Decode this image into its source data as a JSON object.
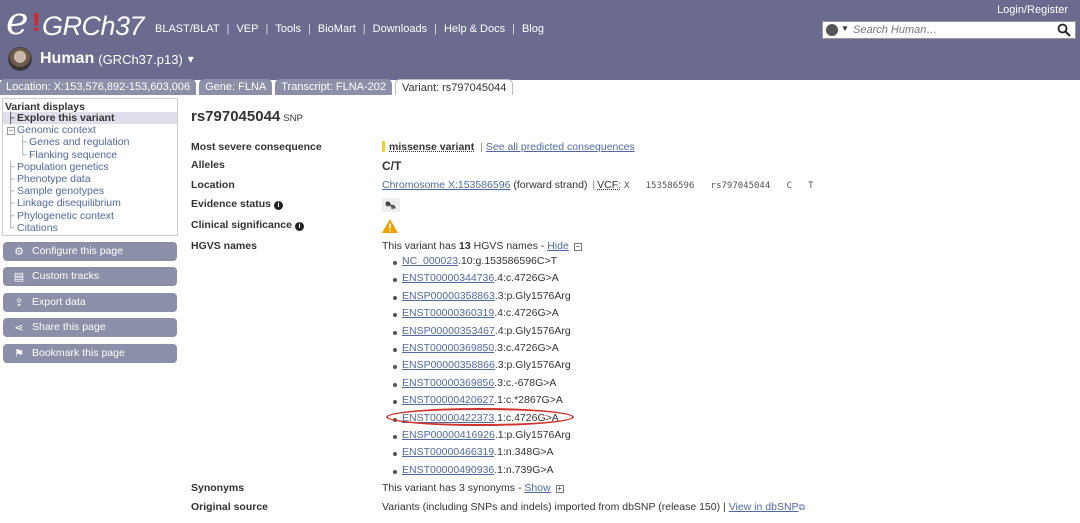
{
  "masthead": {
    "logo_e": "e",
    "logo_bang": "!",
    "logo_name": "GRCh37",
    "nav": [
      "BLAST/BLAT",
      "VEP",
      "Tools",
      "BioMart",
      "Downloads",
      "Help & Docs",
      "Blog"
    ],
    "login": "Login/Register",
    "search_placeholder": "Search Human…",
    "species_name": "Human",
    "species_assembly": "(GRCh37.p13)",
    "species_dropdown": "▾"
  },
  "tabs": [
    {
      "label": "Location: X:153,576,892-153,603,006"
    },
    {
      "label": "Gene: FLNA"
    },
    {
      "label": "Transcript: FLNA-202"
    },
    {
      "label": "Variant: rs797045044"
    }
  ],
  "sidebar": {
    "header": "Variant displays",
    "items": [
      {
        "label": "Explore this variant"
      },
      {
        "label": "Genomic context"
      },
      {
        "label": "Genes and regulation"
      },
      {
        "label": "Flanking sequence"
      },
      {
        "label": "Population genetics"
      },
      {
        "label": "Phenotype data"
      },
      {
        "label": "Sample genotypes"
      },
      {
        "label": "Linkage disequilibrium"
      },
      {
        "label": "Phylogenetic context"
      },
      {
        "label": "Citations"
      }
    ],
    "buttons": [
      {
        "label": "Configure this page"
      },
      {
        "label": "Custom tracks"
      },
      {
        "label": "Export data"
      },
      {
        "label": "Share this page"
      },
      {
        "label": "Bookmark this page"
      }
    ]
  },
  "variant": {
    "id": "rs797045044",
    "type": "SNP",
    "most_severe_label": "Most severe consequence",
    "most_severe_value": "missense variant",
    "see_all": "See all predicted consequences",
    "alleles_label": "Alleles",
    "alleles_value": "C/T",
    "location_label": "Location",
    "location_link": "Chromosome X:153586596",
    "location_strand": "(forward strand)",
    "vcf_label": "VCF:",
    "vcf_value": "X   153586596   rs797045044   C   T",
    "evidence_label": "Evidence status",
    "clinical_label": "Clinical significance",
    "hgvs_label": "HGVS names",
    "hgvs_intro_pre": "This variant has",
    "hgvs_count": "13",
    "hgvs_intro_post": "HGVS names -",
    "hgvs_hide": "Hide",
    "hgvs": [
      {
        "id": "NC_000023",
        "suffix": ".10:g.153586596C>T"
      },
      {
        "id": "ENST00000344736",
        "suffix": ".4:c.4726G>A"
      },
      {
        "id": "ENSP00000358863",
        "suffix": ".3:p.Gly1576Arg"
      },
      {
        "id": "ENST00000360319",
        "suffix": ".4:c.4726G>A"
      },
      {
        "id": "ENSP00000353467",
        "suffix": ".4:p.Gly1576Arg"
      },
      {
        "id": "ENST00000369850",
        "suffix": ".3:c.4726G>A"
      },
      {
        "id": "ENSP00000358866",
        "suffix": ".3:p.Gly1576Arg"
      },
      {
        "id": "ENST00000369856",
        "suffix": ".3:c.-678G>A"
      },
      {
        "id": "ENST00000420627",
        "suffix": ".1:c.*2867G>A"
      },
      {
        "id": "ENST00000422373",
        "suffix": ".1:c.4726G>A"
      },
      {
        "id": "ENSP00000416926",
        "suffix": ".1:p.Gly1576Arg"
      },
      {
        "id": "ENST00000466319",
        "suffix": ".1:n.348G>A"
      },
      {
        "id": "ENST00000490936",
        "suffix": ".1:n.739G>A"
      }
    ],
    "synonyms_label": "Synonyms",
    "synonyms_text": "This variant has 3 synonyms -",
    "synonyms_show": "Show",
    "source_label": "Original source",
    "source_text": "Variants (including SNPs and indels) imported from dbSNP (release 150) |",
    "source_link": "View in dbSNP"
  },
  "colors": {
    "masthead": "#6b6a8f",
    "tab": "#8c8fa8",
    "link": "#5168a2",
    "highlight_circle": "#d0322e",
    "consequence_bar": "#f5d020"
  }
}
